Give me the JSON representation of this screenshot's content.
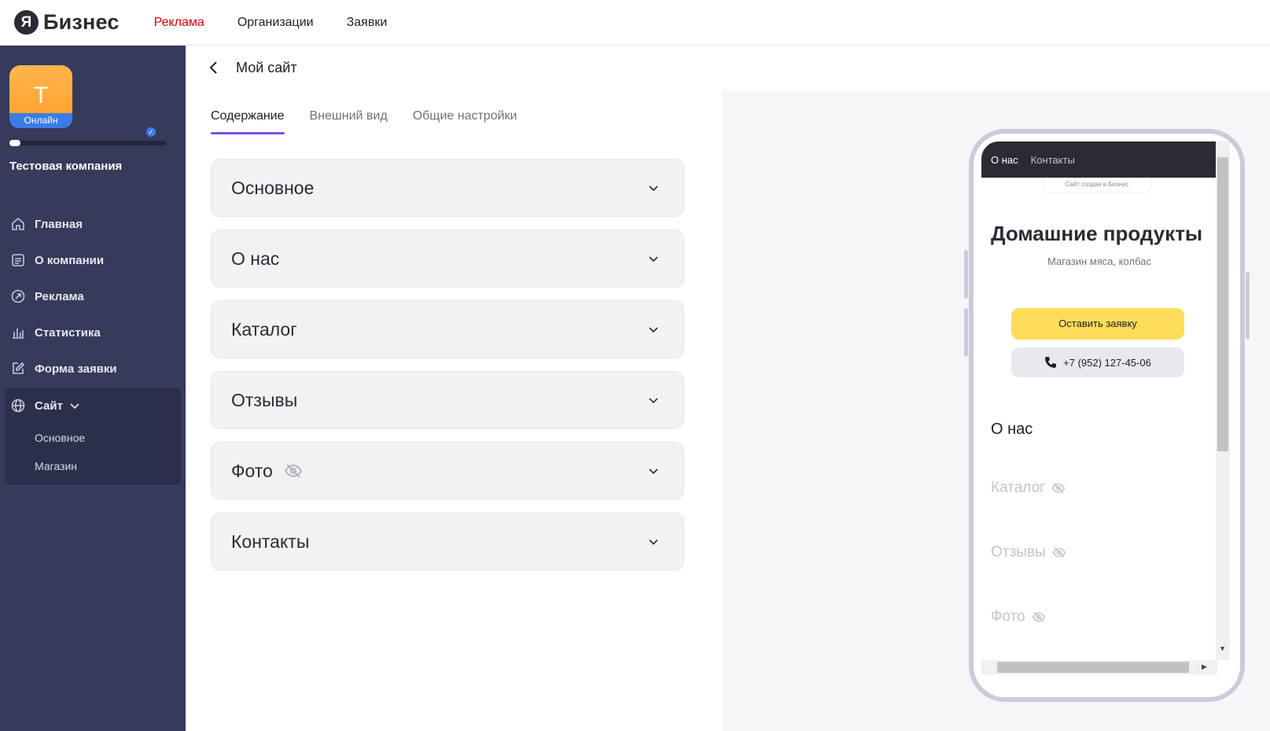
{
  "header": {
    "logo_letter": "Я",
    "logo_text": "Бизнес",
    "nav": [
      "Реклама",
      "Организации",
      "Заявки"
    ],
    "active_nav": "Реклама",
    "active_color": "#d90000"
  },
  "sidebar": {
    "avatar_letter": "T",
    "avatar_badge": "Онлайн",
    "company_name": "Тестовая компания",
    "setup_progress": 0.07,
    "menu": [
      {
        "label": "Главная",
        "icon": "home-icon"
      },
      {
        "label": "О компании",
        "icon": "document-icon"
      },
      {
        "label": "Реклама",
        "icon": "ads-icon"
      },
      {
        "label": "Статистика",
        "icon": "stats-icon"
      },
      {
        "label": "Форма заявки",
        "icon": "edit-icon"
      }
    ],
    "site": {
      "label": "Сайт",
      "icon": "globe-icon",
      "children": [
        "Основное",
        "Магазин"
      ]
    }
  },
  "main": {
    "title": "Мой сайт",
    "tabs": [
      "Содержание",
      "Внешний вид",
      "Общие настройки"
    ],
    "active_tab": "Содержание",
    "sections": [
      {
        "label": "Основное",
        "hidden": false
      },
      {
        "label": "О нас",
        "hidden": false
      },
      {
        "label": "Каталог",
        "hidden": false
      },
      {
        "label": "Отзывы",
        "hidden": false
      },
      {
        "label": "Фото",
        "hidden": true
      },
      {
        "label": "Контакты",
        "hidden": false
      }
    ]
  },
  "preview": {
    "nav": [
      "О нас",
      "Контакты"
    ],
    "created_with": "Сайт создан в  Бизнес",
    "title": "Домашние продукты",
    "subtitle": "Магазин мяса, колбас",
    "cta": "Оставить заявку",
    "phone": "+7 (952) 127-45-06",
    "about_heading": "О нас",
    "hidden_sections": [
      "Каталог",
      "Отзывы",
      "Фото"
    ]
  }
}
